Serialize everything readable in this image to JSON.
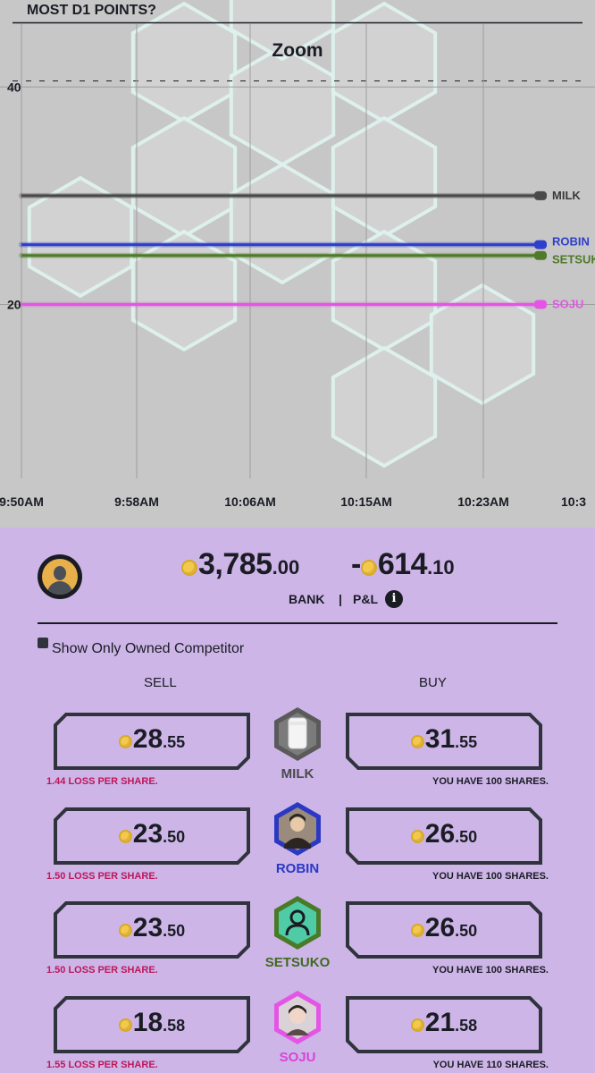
{
  "chart": {
    "title": "MOST D1 POINTS?",
    "zoom_label": "Zoom",
    "y_ticks": [
      {
        "value": 40,
        "label": "40"
      },
      {
        "value": 20,
        "label": "20"
      }
    ],
    "x_ticks": [
      "9:50AM",
      "9:58AM",
      "10:06AM",
      "10:15AM",
      "10:23AM",
      "10:3"
    ]
  },
  "chart_data": {
    "type": "line",
    "title": "MOST D1 POINTS?",
    "xlabel": "",
    "ylabel": "",
    "x": [
      "9:50AM",
      "9:58AM",
      "10:06AM",
      "10:15AM",
      "10:23AM"
    ],
    "ylim": [
      4,
      48
    ],
    "grid": true,
    "series": [
      {
        "name": "MILK",
        "color": "#4a4a4a",
        "values": [
          30,
          30,
          30,
          30,
          30
        ]
      },
      {
        "name": "ROBIN",
        "color": "#2f3ecb",
        "values": [
          25.5,
          25.5,
          25.5,
          25.5,
          25.5
        ]
      },
      {
        "name": "SETSUKO",
        "color": "#4f7a2a",
        "values": [
          24.5,
          24.5,
          24.5,
          24.5,
          24.5
        ]
      },
      {
        "name": "SOJU",
        "color": "#e455e6",
        "values": [
          20,
          20,
          20,
          20,
          20
        ]
      }
    ]
  },
  "account": {
    "bank_int": "3,785",
    "bank_dec": ".00",
    "bank_label": "BANK",
    "separator": "|",
    "pl_sign": "-",
    "pl_int": "614",
    "pl_dec": ".10",
    "pl_label": "P&L",
    "info_glyph": "i"
  },
  "filter": {
    "label": "Show Only Owned Competitor",
    "checked": true
  },
  "columns": {
    "sell": "SELL",
    "buy": "BUY"
  },
  "competitors": [
    {
      "name": "MILK",
      "name_color": "#4a4a4a",
      "icon": "milk-glass-icon",
      "hex_color": "#5a5a5a",
      "sell_int": "28",
      "sell_dec": ".55",
      "buy_int": "31",
      "buy_dec": ".55",
      "loss_note": "1.44 LOSS PER SHARE.",
      "have_note": "YOU HAVE 100 SHARES."
    },
    {
      "name": "ROBIN",
      "name_color": "#2a38c4",
      "icon": "robin-avatar-icon",
      "hex_color": "#2a38c4",
      "sell_int": "23",
      "sell_dec": ".50",
      "buy_int": "26",
      "buy_dec": ".50",
      "loss_note": "1.50 LOSS PER SHARE.",
      "have_note": "YOU HAVE 100 SHARES."
    },
    {
      "name": "SETSUKO",
      "name_color": "#3f6a1f",
      "icon": "person-outline-icon",
      "hex_color": "#4a7a27",
      "sell_int": "23",
      "sell_dec": ".50",
      "buy_int": "26",
      "buy_dec": ".50",
      "loss_note": "1.50 LOSS PER SHARE.",
      "have_note": "YOU HAVE 100 SHARES."
    },
    {
      "name": "SOJU",
      "name_color": "#d943d9",
      "icon": "soju-avatar-icon",
      "hex_color": "#e455e6",
      "sell_int": "18",
      "sell_dec": ".58",
      "buy_int": "21",
      "buy_dec": ".58",
      "loss_note": "1.55 LOSS PER SHARE.",
      "have_note": "YOU HAVE 110 SHARES."
    }
  ]
}
